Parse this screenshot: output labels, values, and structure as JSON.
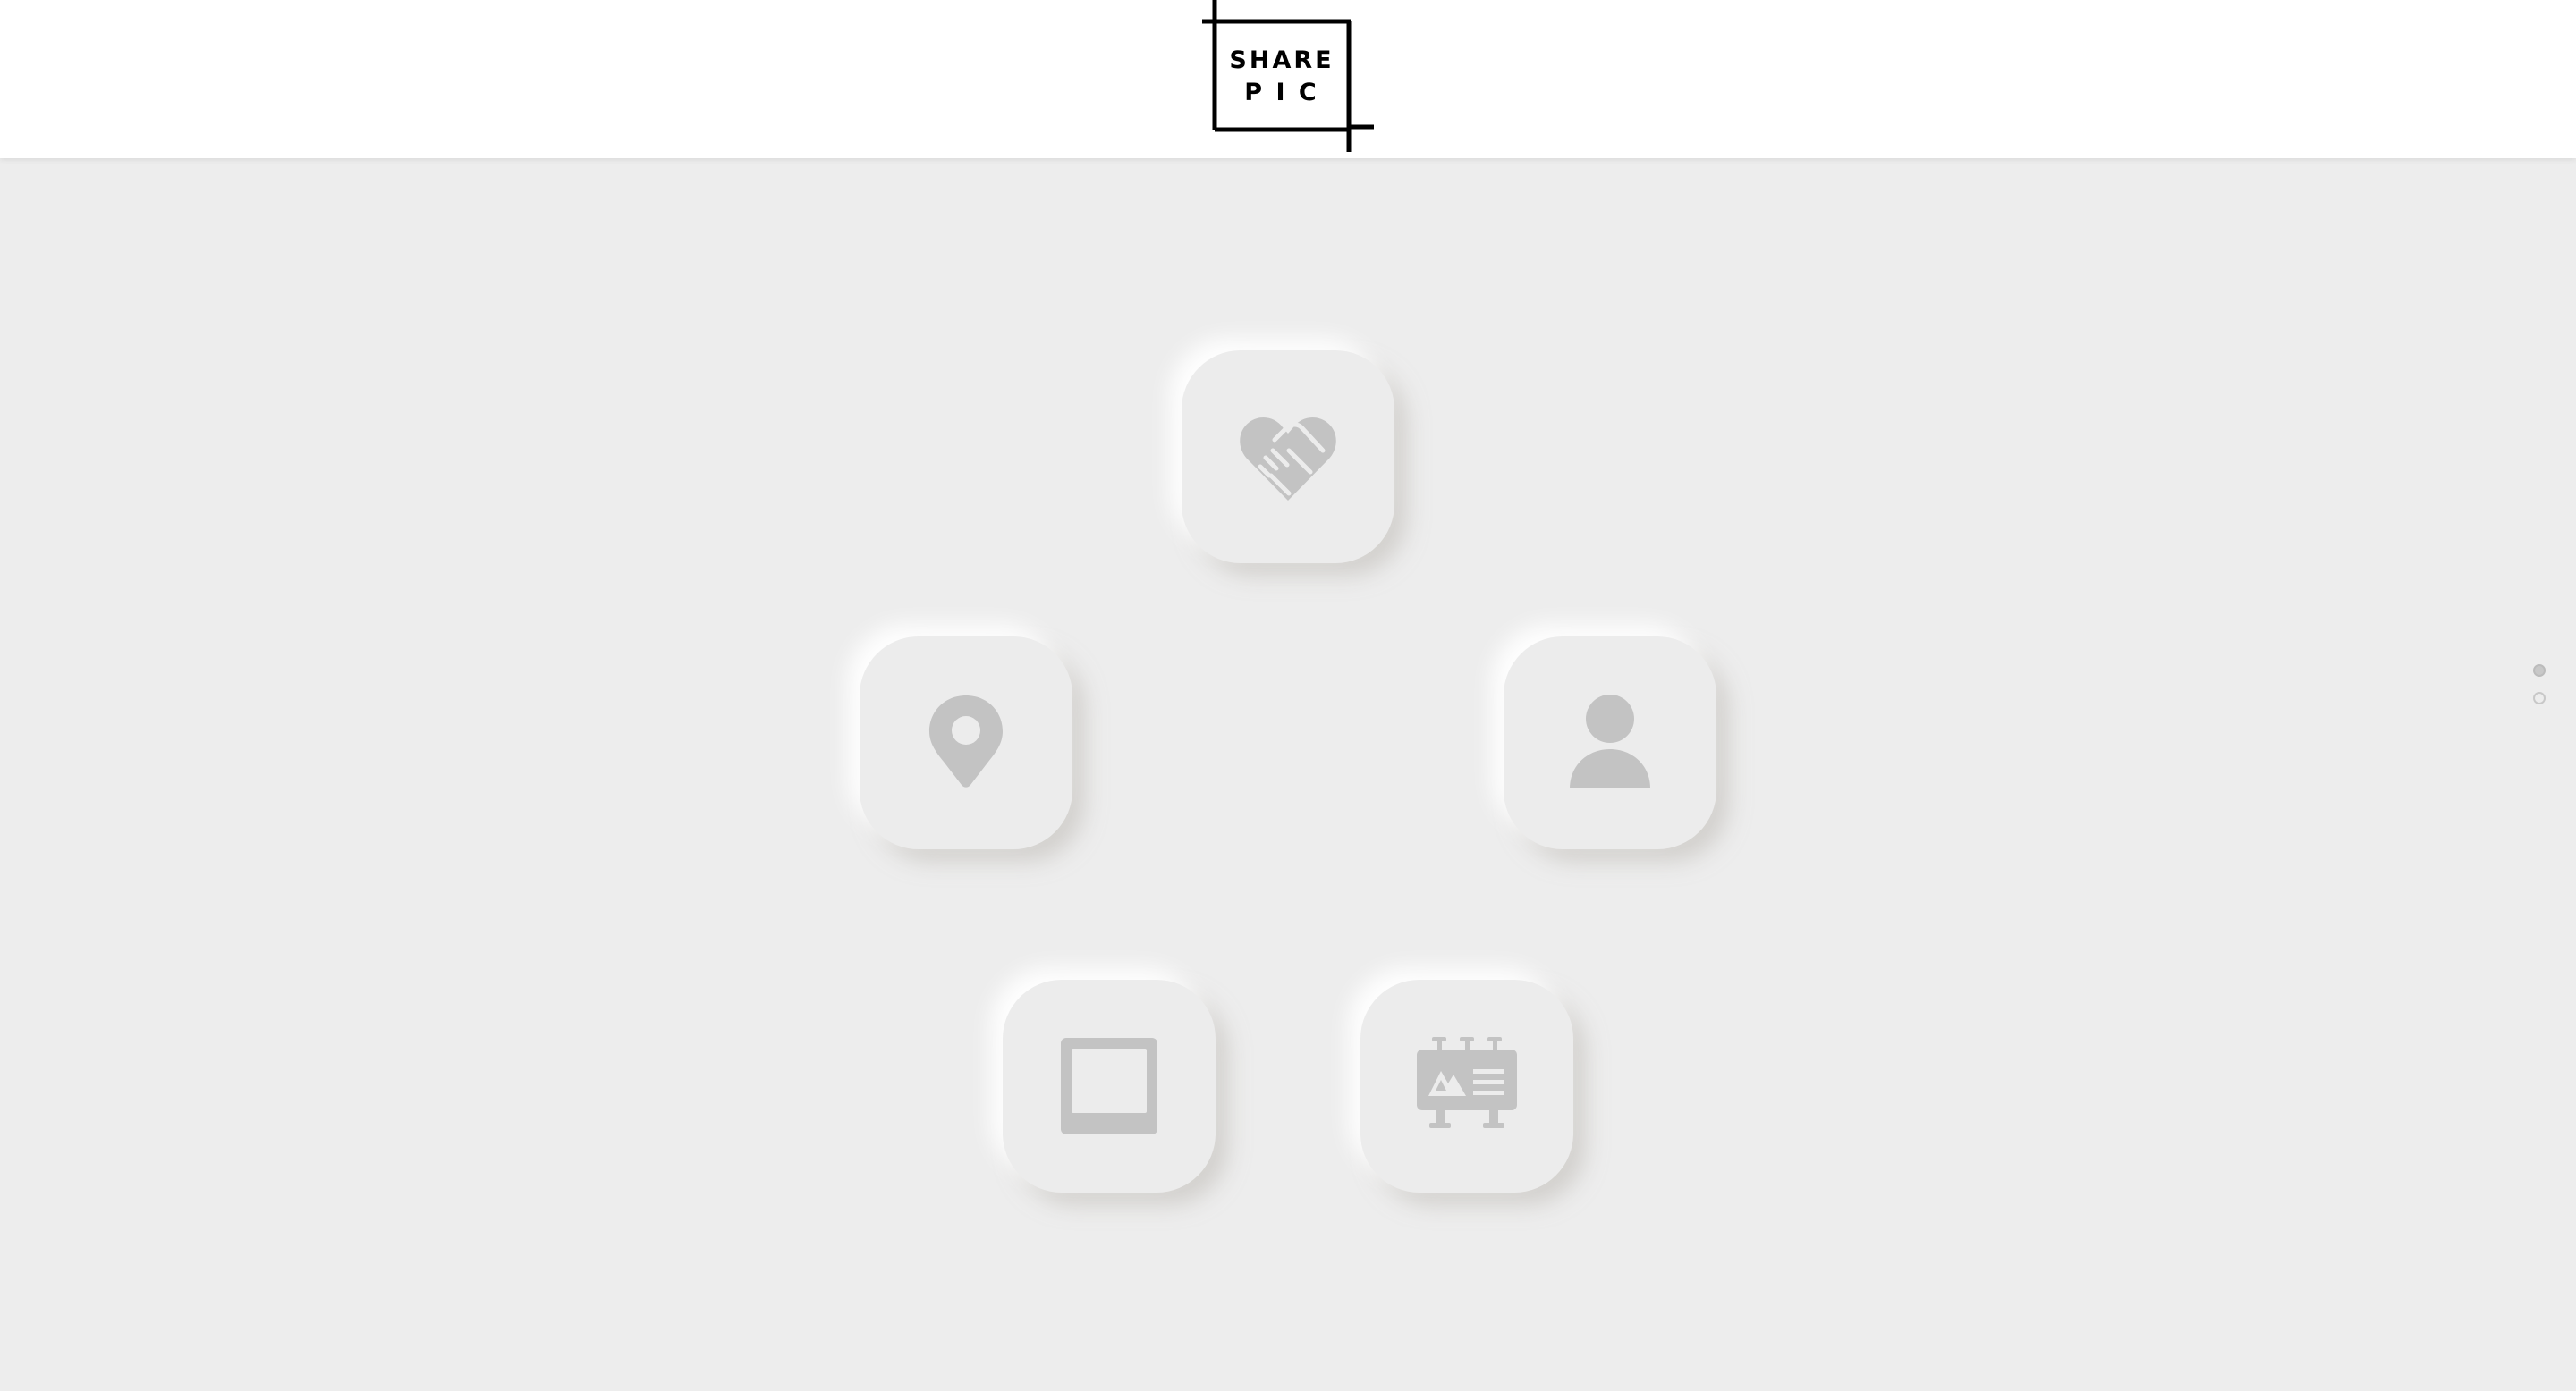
{
  "header": {
    "logo": {
      "line1": "SHARE",
      "line2": "P I C"
    }
  },
  "tiles": [
    {
      "name": "handshake-heart-tile",
      "icon": "handshake-heart-icon"
    },
    {
      "name": "location-pin-tile",
      "icon": "location-pin-icon"
    },
    {
      "name": "user-profile-tile",
      "icon": "user-icon"
    },
    {
      "name": "screen-frame-tile",
      "icon": "screen-frame-icon"
    },
    {
      "name": "billboard-tile",
      "icon": "billboard-icon"
    }
  ],
  "pagination": {
    "pages": 2,
    "active_page": 1
  },
  "colors": {
    "background": "#ededed",
    "header_bg": "#ffffff",
    "icon": "#c3c3c3",
    "logo": "#000000"
  }
}
